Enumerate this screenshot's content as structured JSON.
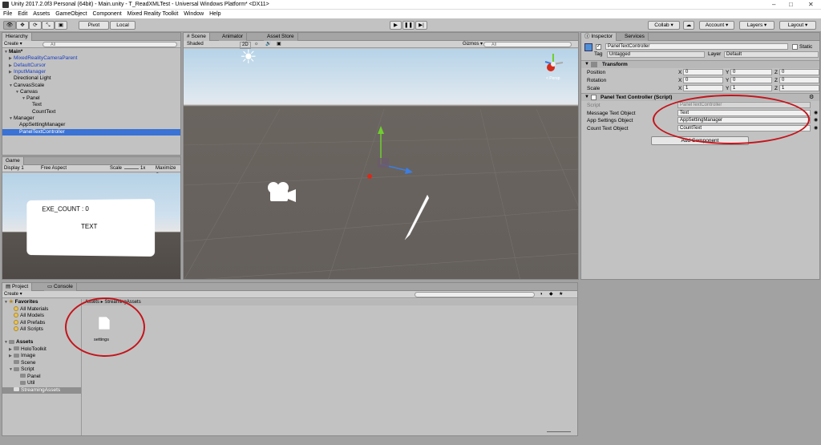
{
  "window": {
    "title": "Unity 2017.2.0f3 Personal (64bit) - Main.unity - T_ReadXMLTest - Universal Windows Platform* <DX11>",
    "min": "–",
    "max": "□",
    "close": "✕"
  },
  "menu": [
    "File",
    "Edit",
    "Assets",
    "GameObject",
    "Component",
    "Mixed Reality Toolkit",
    "Window",
    "Help"
  ],
  "toolbar": {
    "pivot": "Pivot",
    "local": "Local",
    "collab": "Collab ▾",
    "account": "Account ▾",
    "layers": "Layers ▾",
    "layout": "Layout ▾"
  },
  "hierarchy": {
    "tab": "Hierarchy",
    "create": "Create ▾",
    "search": "All",
    "items": [
      {
        "label": "Main*",
        "bold": true
      },
      {
        "label": "MixedRealityCameraParent",
        "blue": true
      },
      {
        "label": "DefaultCursor",
        "blue": true
      },
      {
        "label": "InputManager",
        "blue": true
      },
      {
        "label": "Directional Light"
      },
      {
        "label": "CanvasScale"
      },
      {
        "label": "Canvas"
      },
      {
        "label": "Panel"
      },
      {
        "label": "Text"
      },
      {
        "label": "CountText"
      },
      {
        "label": "Manager"
      },
      {
        "label": "AppSettingManager"
      },
      {
        "label": "PanelTextController",
        "selected": true
      }
    ]
  },
  "scene": {
    "tabs": [
      "Scene",
      "Animator",
      "Asset Store"
    ],
    "shaded": "Shaded",
    "mode2d": "2D",
    "gizmos": "Gizmos ▾",
    "search": "All",
    "persp": "< Persp"
  },
  "game": {
    "tab": "Game",
    "display": "Display 1",
    "aspect": "Free Aspect",
    "scale": "Scale",
    "scale_val": "1x",
    "maximize": "Maximize O",
    "exe_count": "EXE_COUNT : 0",
    "text": "TEXT"
  },
  "inspector": {
    "tabs": [
      "Inspector",
      "Services"
    ],
    "object_name": "PanelTextController",
    "static": "Static",
    "tag_label": "Tag",
    "tag_value": "Untagged",
    "layer_label": "Layer",
    "layer_value": "Default",
    "transform": {
      "title": "Transform",
      "rows": [
        {
          "label": "Position",
          "x": "0",
          "y": "0",
          "z": "0"
        },
        {
          "label": "Rotation",
          "x": "0",
          "y": "0",
          "z": "0"
        },
        {
          "label": "Scale",
          "x": "1",
          "y": "1",
          "z": "1"
        }
      ]
    },
    "script_component": {
      "title": "Panel Text Controller (Script)",
      "script_label": "Script",
      "script_value": "PanelTextController",
      "fields": [
        {
          "label": "Message Text Object",
          "value": "Text"
        },
        {
          "label": "App Settings Object",
          "value": "AppSettingManager"
        },
        {
          "label": "Count Text Object",
          "value": "CountText"
        }
      ]
    },
    "add_component": "Add Component"
  },
  "project": {
    "tabs": [
      "Project",
      "Console"
    ],
    "create": "Create ▾",
    "breadcrumb": "Assets ▸ StreamingAssets",
    "favorites": {
      "title": "Favorites",
      "items": [
        "All Materials",
        "All Models",
        "All Prefabs",
        "All Scripts"
      ]
    },
    "assets": {
      "title": "Assets",
      "items": [
        {
          "label": "HoloToolkit",
          "indent": 1
        },
        {
          "label": "Image",
          "indent": 1
        },
        {
          "label": "Scene",
          "indent": 1
        },
        {
          "label": "Script",
          "indent": 1
        },
        {
          "label": "Panel",
          "indent": 2
        },
        {
          "label": "Util",
          "indent": 2
        },
        {
          "label": "StreamingAssets",
          "indent": 1,
          "selected": true
        }
      ]
    },
    "file": "settings"
  },
  "colors": {
    "accent": "#3a72d6",
    "annotation": "#c4141b",
    "sky": "#cfe0ee",
    "ground": "#5f5a56"
  }
}
